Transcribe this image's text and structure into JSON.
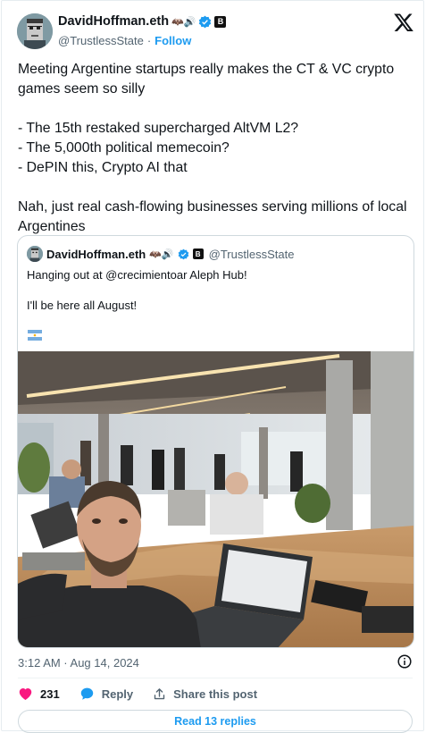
{
  "author": {
    "display_name": "DavidHoffman.eth",
    "name_emojis": "🦇🔊",
    "badge_letter": "B",
    "handle": "@TrustlessState",
    "separator": "·",
    "follow_label": "Follow"
  },
  "tweet": {
    "paragraphs": [
      "Meeting Argentine startups really makes the CT & VC crypto games seem so silly"
    ],
    "bullets": [
      "- The 15th restaked supercharged AltVM L2?",
      "- The 5,000th political memecoin?",
      "- DePIN this, Crypto AI that"
    ],
    "closing": "Nah, just real cash-flowing businesses serving millions of local Argentines"
  },
  "quoted": {
    "display_name": "DavidHoffman.eth",
    "name_emojis": "🦇🔊",
    "badge_letter": "B",
    "handle": "@TrustlessState",
    "line1": "Hanging out at @crecimientoar Aleph Hub!",
    "line2": "I'll be here all August!"
  },
  "meta": {
    "timestamp": "3:12 AM · Aug 14, 2024"
  },
  "actions": {
    "like_count": "231",
    "reply_label": "Reply",
    "share_label": "Share this post"
  },
  "read_replies_label": "Read 13 replies",
  "colors": {
    "accent": "#1d9bf0",
    "like": "#f91880",
    "text": "#0f1419",
    "muted": "#536471",
    "border": "#cfd9de"
  },
  "icons": [
    "x-logo-icon",
    "verified-icon",
    "heart-icon",
    "reply-bubble-icon",
    "share-icon",
    "info-icon",
    "argentina-flag-icon"
  ]
}
